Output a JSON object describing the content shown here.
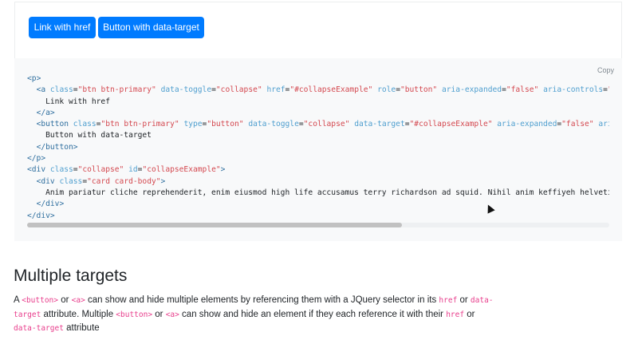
{
  "example": {
    "link_label": "Link with href",
    "button_label": "Button with data-target"
  },
  "code": {
    "copy_label": "Copy",
    "lines": [
      "<p>",
      "  <a class=\"btn btn-primary\" data-toggle=\"collapse\" href=\"#collapseExample\" role=\"button\" aria-expanded=\"false\" aria-controls=\"collapseExample\">",
      "    Link with href",
      "  </a>",
      "  <button class=\"btn btn-primary\" type=\"button\" data-toggle=\"collapse\" data-target=\"#collapseExample\" aria-expanded=\"false\" aria-controls=\"collapseExample\">",
      "    Button with data-target",
      "  </button>",
      "</p>",
      "<div class=\"collapse\" id=\"collapseExample\">",
      "  <div class=\"card card-body\">",
      "    Anim pariatur cliche reprehenderit, enim eiusmod high life accusamus terry richardson ad squid. Nihil anim keffiyeh helvetica",
      "  </div>",
      "</div>"
    ]
  },
  "section": {
    "heading": "Multiple targets",
    "p1": "A ",
    "c1": "<button>",
    "p2": " or ",
    "c2": "<a>",
    "p3": " can show and hide multiple elements by referencing them with a JQuery selector in its ",
    "c3": "href",
    "p4": " or ",
    "c4": "data-target",
    "p5": " attribute. Multiple ",
    "c5": "<button>",
    "p6": " or ",
    "c6": "<a>",
    "p7": " can show and hide an element if they each reference it with their ",
    "c7": "href",
    "p8": " or ",
    "c8": "data-target",
    "p9": " attribute"
  },
  "colors": {
    "primary": "#007bff",
    "code_tag": "#2f6f9f",
    "code_attr": "#4f9fcf",
    "code_value": "#d44950",
    "inline_code": "#e83e8c"
  }
}
